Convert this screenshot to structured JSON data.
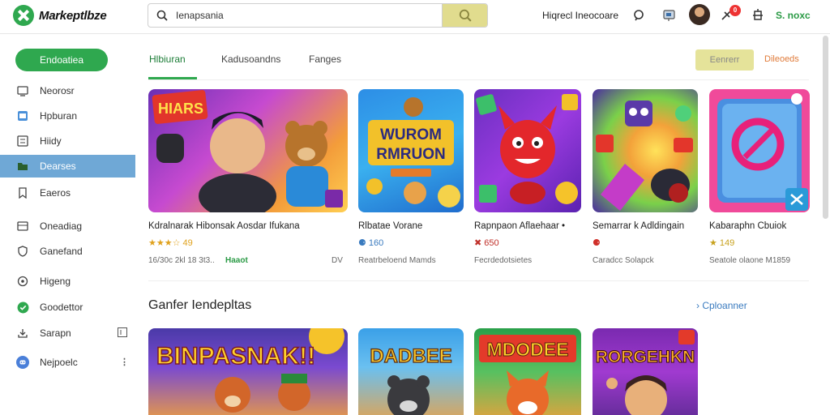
{
  "header": {
    "logo_text": "Markeptlbze",
    "search": {
      "value": "Ienapsania",
      "placeholder": ""
    },
    "link": "Hiqrecl Ineocoare",
    "badge_count": "0",
    "right_label": "S. noxc"
  },
  "sidebar": {
    "primary_button": "Endoatiea",
    "items": [
      {
        "label": "Neorosr",
        "icon": "monitor-icon"
      },
      {
        "label": "Hpburan",
        "icon": "window-icon"
      },
      {
        "label": "Hiidy",
        "icon": "list-icon"
      },
      {
        "label": "Dearses",
        "icon": "folder-icon"
      },
      {
        "label": "Eaeros",
        "icon": "bookmark-icon"
      },
      {
        "label": "Oneadiag",
        "icon": "box-icon"
      },
      {
        "label": "Ganefand",
        "icon": "shield-icon"
      },
      {
        "label": "Higeng",
        "icon": "location-icon"
      },
      {
        "label": "Goodettor",
        "icon": "check-circle-icon"
      },
      {
        "label": "Sarapn",
        "icon": "download-icon"
      },
      {
        "label": "Nejpoelc",
        "icon": "discord-icon"
      }
    ],
    "active_index": 3
  },
  "tabs": [
    {
      "label": "Hlbiuran"
    },
    {
      "label": "Kadusoandns"
    },
    {
      "label": "Fanges"
    }
  ],
  "actions": {
    "primary": "Eenrerr",
    "link": "Dileoeds"
  },
  "cards": [
    {
      "title": "Kdralnarak Hibonsak Aosdar Ifukana",
      "rating": "★★★☆ 49",
      "meta": "16/30c 2kl 18 3t3..",
      "meta2": "Haaot",
      "meta3": "DV",
      "thumb_text": "HIARS"
    },
    {
      "title": "Rlbatae Vorane",
      "rating": "⚈ 160",
      "meta": "Reatrbeloend Mamds",
      "thumb_text": "WUROM RMRUON"
    },
    {
      "title": "Rapnpaon Aflaehaar •",
      "rating": "✖ 650",
      "meta": "Fecrdedotsietes",
      "thumb_text": ""
    },
    {
      "title": "Semarrar k Adldingain",
      "rating": "⚈",
      "meta": "Caradcc Solapck",
      "thumb_text": ""
    },
    {
      "title": "Kabaraphn Cbuiok",
      "rating": "★ 149",
      "meta": "Seatole olaone M1859",
      "thumb_text": ""
    }
  ],
  "section2": {
    "title": "Ganfer Iendepltas",
    "link": "Cploanner",
    "cards": [
      {
        "thumb_text": "BINPASNAK!!"
      },
      {
        "thumb_text": "DADBEE"
      },
      {
        "thumb_text": "MDODEE"
      },
      {
        "thumb_text": "RORGEHKN"
      }
    ]
  },
  "colors": {
    "accent": "#2fa84f",
    "active_nav": "#6fa8d6",
    "link_blue": "#3a7bbf",
    "link_orange": "#e07b3a"
  }
}
